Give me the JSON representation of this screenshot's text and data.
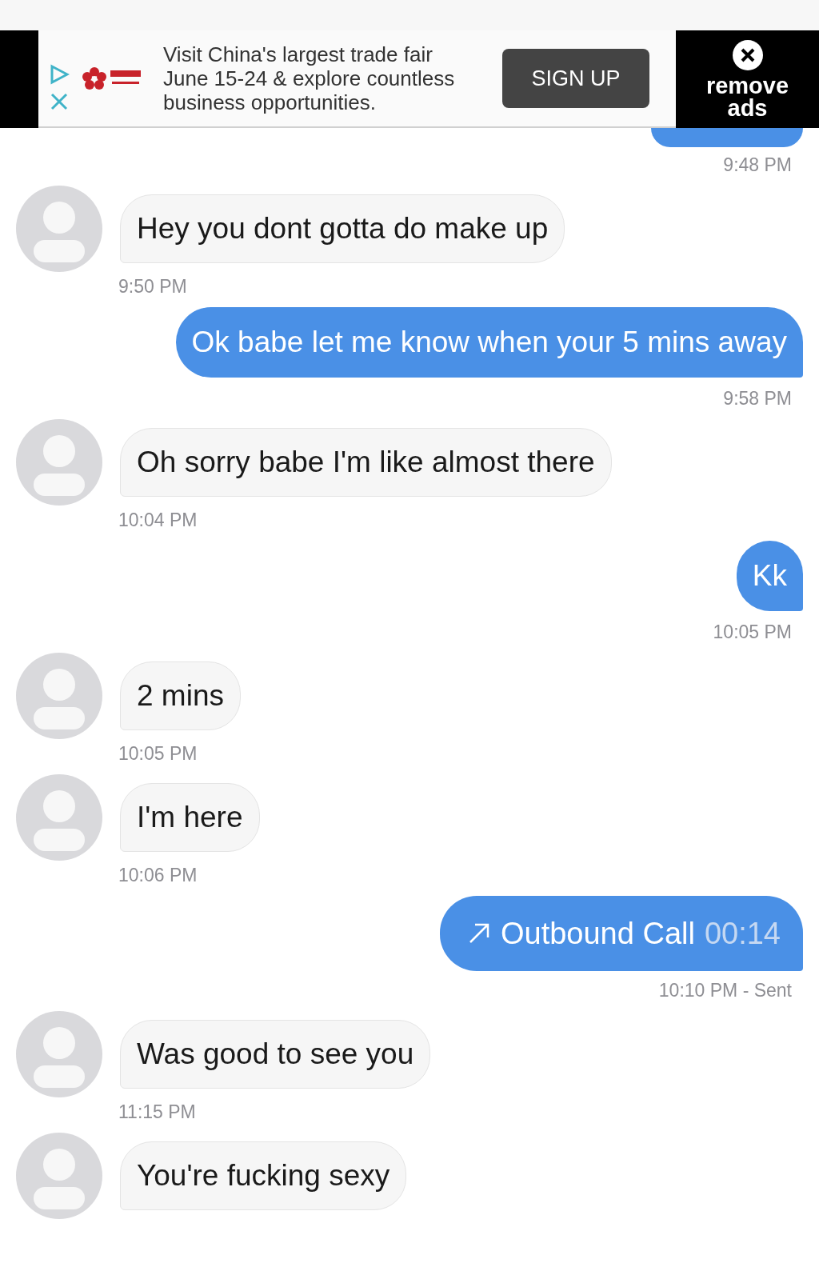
{
  "ad": {
    "headline": "Visit China's largest trade fair June 15-24 & explore countless business opportunities.",
    "button": "SIGN UP",
    "remove": "remove ads"
  },
  "messages": [
    {
      "kind": "outgoing_partial",
      "time": "9:48 PM"
    },
    {
      "kind": "incoming",
      "text": "Hey you dont gotta do make up",
      "time": "9:50 PM"
    },
    {
      "kind": "outgoing",
      "text": "Ok babe let me know when your 5 mins away",
      "time": "9:58 PM"
    },
    {
      "kind": "incoming",
      "text": "Oh sorry babe I'm like almost there",
      "time": "10:04 PM"
    },
    {
      "kind": "outgoing",
      "text": "Kk",
      "time": "10:05 PM"
    },
    {
      "kind": "incoming",
      "text": "2 mins",
      "time": "10:05 PM"
    },
    {
      "kind": "incoming",
      "text": "I'm here",
      "time": "10:06 PM"
    },
    {
      "kind": "call",
      "label": "Outbound Call",
      "duration": "00:14",
      "time": "10:10 PM - Sent"
    },
    {
      "kind": "incoming",
      "text": "Was good to see you",
      "time": "11:15 PM"
    },
    {
      "kind": "incoming",
      "text": "You're fucking sexy"
    }
  ]
}
